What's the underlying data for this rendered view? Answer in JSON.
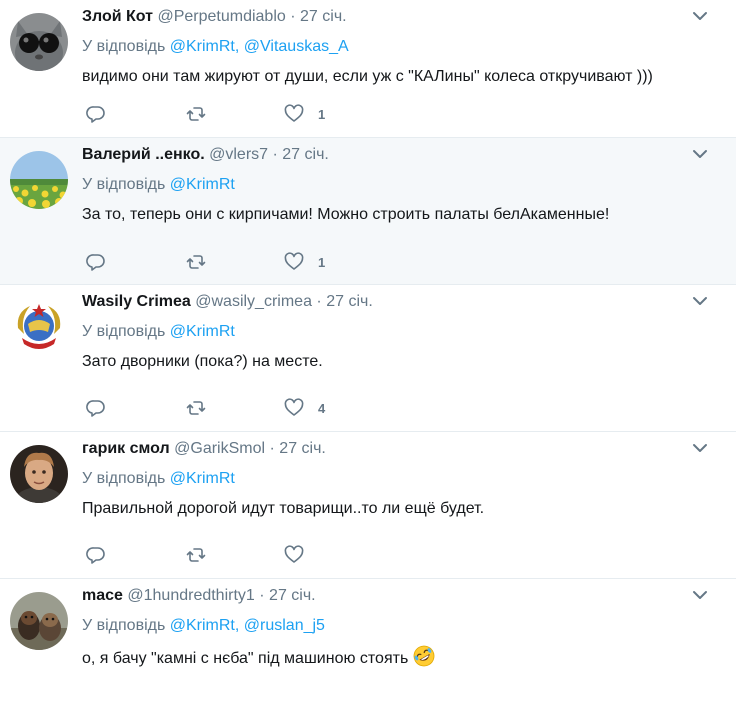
{
  "tweets": [
    {
      "name": "Злой Кот",
      "handle": "@Perpetumdiablo",
      "separator": "·",
      "time": "27 січ.",
      "reply_prefix": "У відповідь",
      "mentions": [
        "@KrimRt,",
        "@Vitauskas_A"
      ],
      "text": "видимо они там жируют от души, если уж с \"КАЛины\" колеса откручивают )))",
      "like_count": "1",
      "avatar": "cat-avatar"
    },
    {
      "name": "Валерий ..енко.",
      "handle": "@vlers7",
      "separator": "·",
      "time": "27 січ.",
      "reply_prefix": "У відповідь",
      "mentions": [
        "@KrimRt"
      ],
      "text": "За то, теперь они с кирпичами! Можно строить палаты белАкаменные!",
      "like_count": "1",
      "avatar": "field-avatar"
    },
    {
      "name": "Wasily Crimea",
      "handle": "@wasily_crimea",
      "separator": "·",
      "time": "27 січ.",
      "reply_prefix": "У відповідь",
      "mentions": [
        "@KrimRt"
      ],
      "text": "Зато дворники (пока?) на месте.",
      "like_count": "4",
      "avatar": "emblem-avatar"
    },
    {
      "name": "гарик смол",
      "handle": "@GarikSmol",
      "separator": "·",
      "time": "27 січ.",
      "reply_prefix": "У відповідь",
      "mentions": [
        "@KrimRt"
      ],
      "text": "Правильной дорогой идут товарищи..то ли ещё будет.",
      "like_count": "",
      "avatar": "portrait-avatar"
    },
    {
      "name": "mace",
      "handle": "@1hundredthirty1",
      "separator": "·",
      "time": "27 січ.",
      "reply_prefix": "У відповідь",
      "mentions": [
        "@KrimRt,",
        "@ruslan_j5"
      ],
      "text": "о, я бачу \"камні с нєба\" під машиною стоять",
      "text_emoji": "rolling-laughing-emoji",
      "like_count": "",
      "avatar": "dogs-avatar"
    }
  ],
  "colors": {
    "link": "#1da1f2",
    "muted": "#657786",
    "text": "#14171a",
    "highlight_bg": "#f5f8fa",
    "divider": "#e6ecf0"
  },
  "icons": {
    "reply": "reply-icon",
    "retweet": "retweet-icon",
    "like": "heart-icon",
    "menu": "chevron-down-icon"
  }
}
